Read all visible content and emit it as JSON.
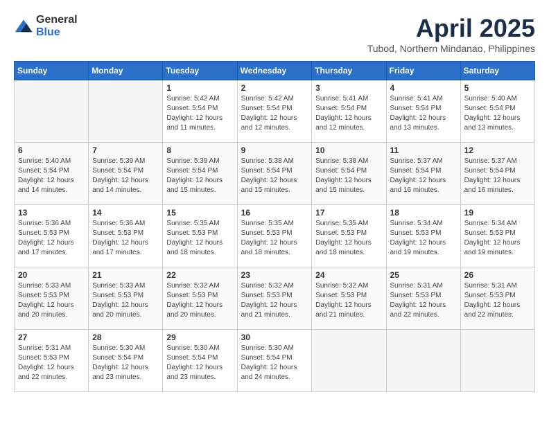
{
  "logo": {
    "general": "General",
    "blue": "Blue"
  },
  "title": {
    "month": "April 2025",
    "location": "Tubod, Northern Mindanao, Philippines"
  },
  "headers": [
    "Sunday",
    "Monday",
    "Tuesday",
    "Wednesday",
    "Thursday",
    "Friday",
    "Saturday"
  ],
  "weeks": [
    [
      {
        "day": "",
        "info": ""
      },
      {
        "day": "",
        "info": ""
      },
      {
        "day": "1",
        "info": "Sunrise: 5:42 AM\nSunset: 5:54 PM\nDaylight: 12 hours and 11 minutes."
      },
      {
        "day": "2",
        "info": "Sunrise: 5:42 AM\nSunset: 5:54 PM\nDaylight: 12 hours and 12 minutes."
      },
      {
        "day": "3",
        "info": "Sunrise: 5:41 AM\nSunset: 5:54 PM\nDaylight: 12 hours and 12 minutes."
      },
      {
        "day": "4",
        "info": "Sunrise: 5:41 AM\nSunset: 5:54 PM\nDaylight: 12 hours and 13 minutes."
      },
      {
        "day": "5",
        "info": "Sunrise: 5:40 AM\nSunset: 5:54 PM\nDaylight: 12 hours and 13 minutes."
      }
    ],
    [
      {
        "day": "6",
        "info": "Sunrise: 5:40 AM\nSunset: 5:54 PM\nDaylight: 12 hours and 14 minutes."
      },
      {
        "day": "7",
        "info": "Sunrise: 5:39 AM\nSunset: 5:54 PM\nDaylight: 12 hours and 14 minutes."
      },
      {
        "day": "8",
        "info": "Sunrise: 5:39 AM\nSunset: 5:54 PM\nDaylight: 12 hours and 15 minutes."
      },
      {
        "day": "9",
        "info": "Sunrise: 5:38 AM\nSunset: 5:54 PM\nDaylight: 12 hours and 15 minutes."
      },
      {
        "day": "10",
        "info": "Sunrise: 5:38 AM\nSunset: 5:54 PM\nDaylight: 12 hours and 15 minutes."
      },
      {
        "day": "11",
        "info": "Sunrise: 5:37 AM\nSunset: 5:54 PM\nDaylight: 12 hours and 16 minutes."
      },
      {
        "day": "12",
        "info": "Sunrise: 5:37 AM\nSunset: 5:54 PM\nDaylight: 12 hours and 16 minutes."
      }
    ],
    [
      {
        "day": "13",
        "info": "Sunrise: 5:36 AM\nSunset: 5:53 PM\nDaylight: 12 hours and 17 minutes."
      },
      {
        "day": "14",
        "info": "Sunrise: 5:36 AM\nSunset: 5:53 PM\nDaylight: 12 hours and 17 minutes."
      },
      {
        "day": "15",
        "info": "Sunrise: 5:35 AM\nSunset: 5:53 PM\nDaylight: 12 hours and 18 minutes."
      },
      {
        "day": "16",
        "info": "Sunrise: 5:35 AM\nSunset: 5:53 PM\nDaylight: 12 hours and 18 minutes."
      },
      {
        "day": "17",
        "info": "Sunrise: 5:35 AM\nSunset: 5:53 PM\nDaylight: 12 hours and 18 minutes."
      },
      {
        "day": "18",
        "info": "Sunrise: 5:34 AM\nSunset: 5:53 PM\nDaylight: 12 hours and 19 minutes."
      },
      {
        "day": "19",
        "info": "Sunrise: 5:34 AM\nSunset: 5:53 PM\nDaylight: 12 hours and 19 minutes."
      }
    ],
    [
      {
        "day": "20",
        "info": "Sunrise: 5:33 AM\nSunset: 5:53 PM\nDaylight: 12 hours and 20 minutes."
      },
      {
        "day": "21",
        "info": "Sunrise: 5:33 AM\nSunset: 5:53 PM\nDaylight: 12 hours and 20 minutes."
      },
      {
        "day": "22",
        "info": "Sunrise: 5:32 AM\nSunset: 5:53 PM\nDaylight: 12 hours and 20 minutes."
      },
      {
        "day": "23",
        "info": "Sunrise: 5:32 AM\nSunset: 5:53 PM\nDaylight: 12 hours and 21 minutes."
      },
      {
        "day": "24",
        "info": "Sunrise: 5:32 AM\nSunset: 5:53 PM\nDaylight: 12 hours and 21 minutes."
      },
      {
        "day": "25",
        "info": "Sunrise: 5:31 AM\nSunset: 5:53 PM\nDaylight: 12 hours and 22 minutes."
      },
      {
        "day": "26",
        "info": "Sunrise: 5:31 AM\nSunset: 5:53 PM\nDaylight: 12 hours and 22 minutes."
      }
    ],
    [
      {
        "day": "27",
        "info": "Sunrise: 5:31 AM\nSunset: 5:53 PM\nDaylight: 12 hours and 22 minutes."
      },
      {
        "day": "28",
        "info": "Sunrise: 5:30 AM\nSunset: 5:54 PM\nDaylight: 12 hours and 23 minutes."
      },
      {
        "day": "29",
        "info": "Sunrise: 5:30 AM\nSunset: 5:54 PM\nDaylight: 12 hours and 23 minutes."
      },
      {
        "day": "30",
        "info": "Sunrise: 5:30 AM\nSunset: 5:54 PM\nDaylight: 12 hours and 24 minutes."
      },
      {
        "day": "",
        "info": ""
      },
      {
        "day": "",
        "info": ""
      },
      {
        "day": "",
        "info": ""
      }
    ]
  ]
}
